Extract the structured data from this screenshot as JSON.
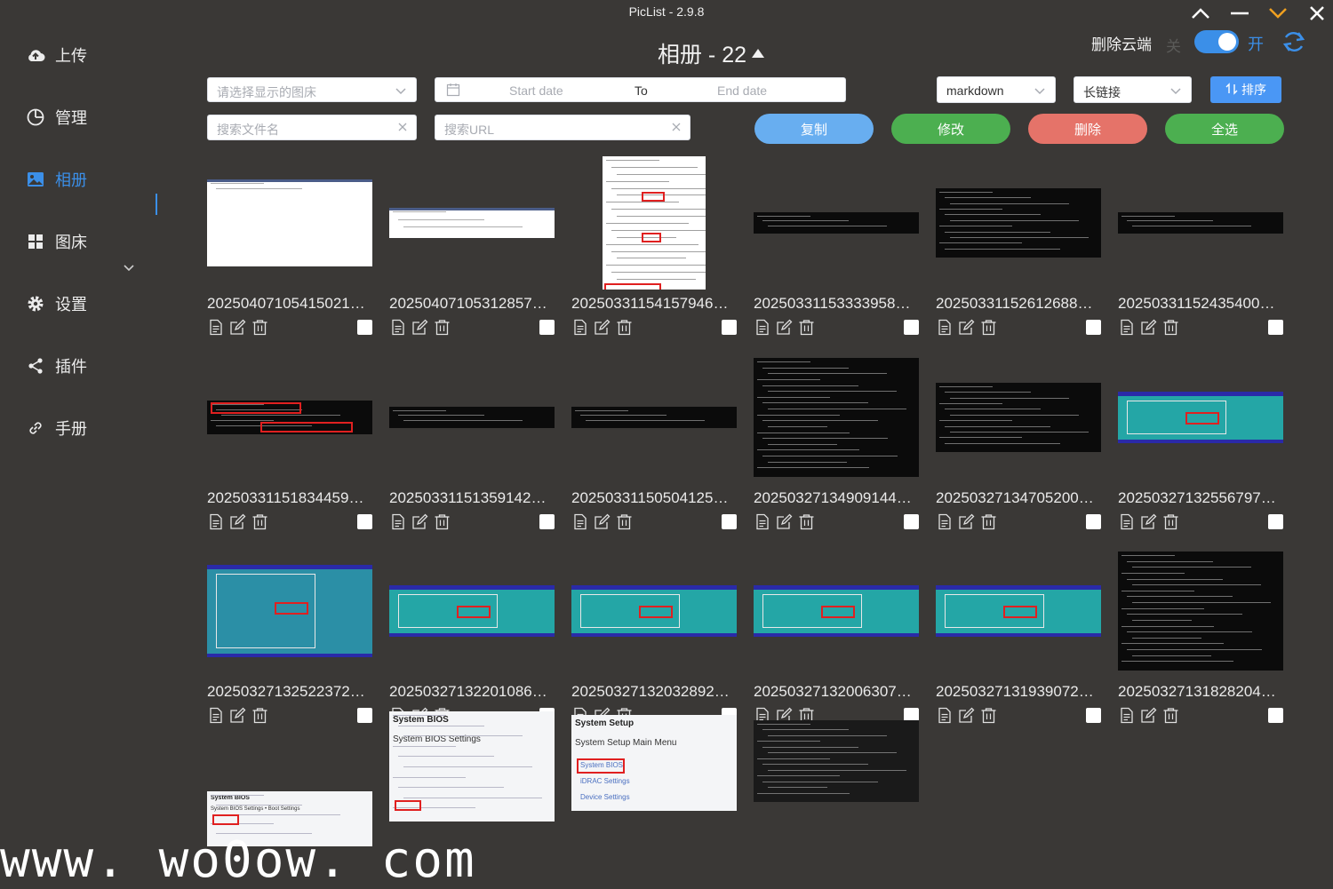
{
  "window": {
    "title": "PicList - 2.9.8",
    "controls": [
      "collapse",
      "minimize",
      "fold",
      "close"
    ]
  },
  "sidebar": {
    "items": [
      {
        "label": "上传",
        "icon": "upload-cloud-icon"
      },
      {
        "label": "管理",
        "icon": "pie-chart-icon"
      },
      {
        "label": "相册",
        "icon": "picture-icon",
        "active": true
      },
      {
        "label": "图床",
        "icon": "grid-icon",
        "expandable": true
      },
      {
        "label": "设置",
        "icon": "gear-icon"
      },
      {
        "label": "插件",
        "icon": "share-icon"
      },
      {
        "label": "手册",
        "icon": "link-icon"
      }
    ]
  },
  "header": {
    "album_title": "相册 - 22",
    "cloud_delete_label": "删除云端",
    "toggle_off_label": "关",
    "toggle_on_label": "开",
    "toggle_state": true
  },
  "filters": {
    "bed_select_placeholder": "请选择显示的图床",
    "start_date_placeholder": "Start date",
    "range_separator": "To",
    "end_date_placeholder": "End date",
    "format_select": "markdown",
    "link_select": "长链接",
    "sort_label": "排序",
    "search_file_placeholder": "搜索文件名",
    "search_url_placeholder": "搜索URL"
  },
  "actions": {
    "copy": "复制",
    "edit": "修改",
    "delete": "删除",
    "select_all": "全选"
  },
  "colors": {
    "accent": "#3b8fe8",
    "copy": "#68aef0",
    "edit": "#4caf50",
    "delete": "#e57369",
    "select_all": "#4caf50",
    "background": "#3a3836"
  },
  "gallery": [
    {
      "name": "20250407105415021…",
      "style": "white"
    },
    {
      "name": "20250407105312857…",
      "style": "white-strip"
    },
    {
      "name": "20250331154157946…",
      "style": "doc-tall"
    },
    {
      "name": "20250331153333958…",
      "style": "term-thin"
    },
    {
      "name": "20250331152612688…",
      "style": "term"
    },
    {
      "name": "20250331152435400…",
      "style": "term-thin"
    },
    {
      "name": "20250331151834459…",
      "style": "term-red"
    },
    {
      "name": "20250331151359142…",
      "style": "term-thin"
    },
    {
      "name": "20250331150504125…",
      "style": "term-thin"
    },
    {
      "name": "20250327134909144…",
      "style": "term-big"
    },
    {
      "name": "20250327134705200…",
      "style": "term"
    },
    {
      "name": "20250327132556797…",
      "style": "teal"
    },
    {
      "name": "20250327132522372…",
      "style": "teal-photo"
    },
    {
      "name": "20250327132201086…",
      "style": "teal"
    },
    {
      "name": "20250327132032892…",
      "style": "teal"
    },
    {
      "name": "20250327132006307…",
      "style": "teal"
    },
    {
      "name": "20250327131939072…",
      "style": "teal"
    },
    {
      "name": "20250327131828204…",
      "style": "term-big"
    },
    {
      "name": "",
      "style": "bios",
      "caption": "System BIOS",
      "subcaption": "System BIOS Settings • Boot Settings"
    },
    {
      "name": "",
      "style": "bios-tall",
      "caption": "System BIOS",
      "subcaption": "System BIOS Settings"
    },
    {
      "name": "",
      "style": "bios-setup",
      "caption": "System Setup",
      "subcaption": "System Setup Main Menu",
      "items": [
        "System BIOS",
        "iDRAC Settings",
        "Device Settings"
      ]
    },
    {
      "name": "",
      "style": "term-dim"
    }
  ],
  "watermark": "www. wo0ow. com"
}
